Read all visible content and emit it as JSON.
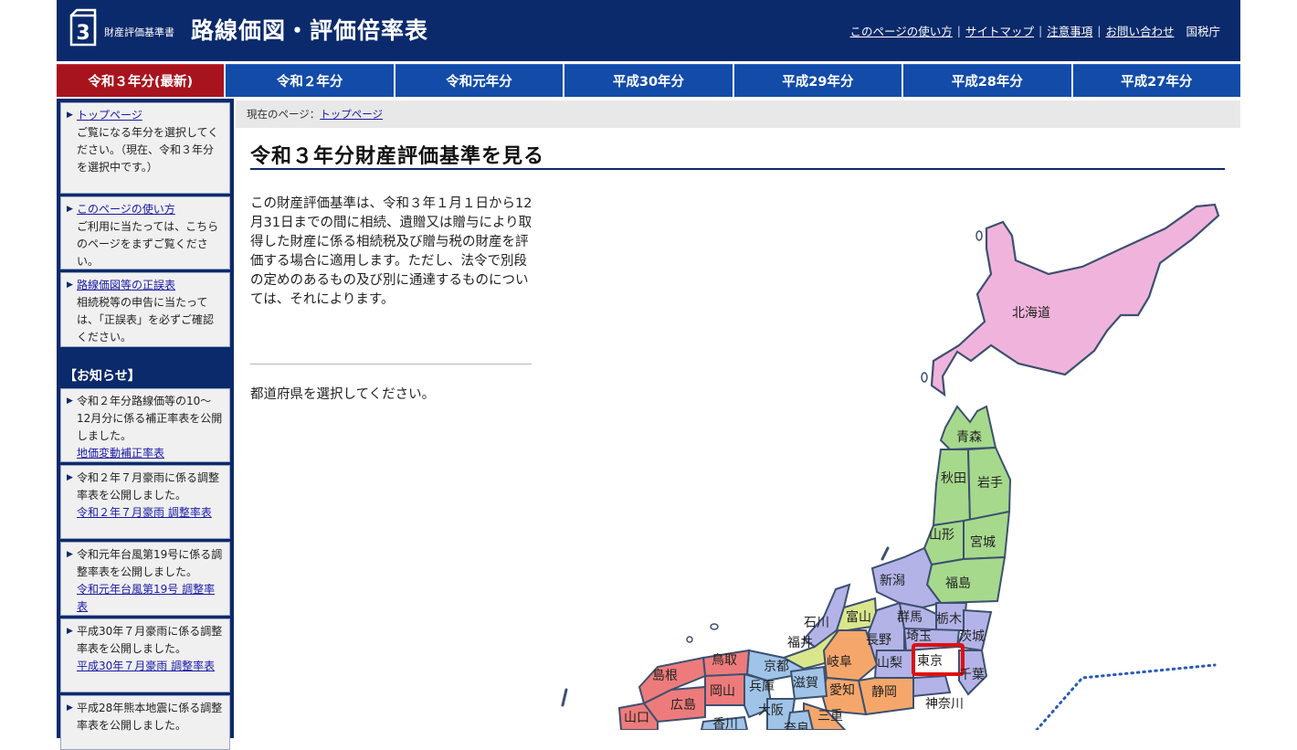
{
  "header": {
    "logo_number": "3",
    "logo_sub": "財産評価基準書",
    "logo_main": "路線価図・評価倍率表",
    "utility_links": [
      "このページの使い方",
      "サイトマップ",
      "注意事項",
      "お問い合わせ"
    ],
    "agency": "国税庁"
  },
  "tabs": [
    "令和３年分(最新)",
    "令和２年分",
    "令和元年分",
    "平成30年分",
    "平成29年分",
    "平成28年分",
    "平成27年分"
  ],
  "sidebar": {
    "top": {
      "link": "トップページ",
      "text": "ご覧になる年分を選択してください。（現在、令和３年分を選択中です。）"
    },
    "usage": {
      "link": "このページの使い方",
      "text": "ご利用に当たっては、こちらのページをまずご覧ください。"
    },
    "errata": {
      "link": "路線価図等の正誤表",
      "text": "相続税等の申告に当たっては、「正誤表」を必ずご確認ください。"
    },
    "notice_heading": "【お知らせ】",
    "notices": [
      {
        "text": "令和２年分路線価等の10～12月分に係る補正率表を公開しました。",
        "link": "地価変動補正率表"
      },
      {
        "text": "令和２年７月豪雨に係る調整率表を公開しました。",
        "link": "令和２年７月豪雨 調整率表"
      },
      {
        "text": "令和元年台風第19号に係る調整率表を公開しました。",
        "link": "令和元年台風第19号 調整率表"
      },
      {
        "text": "平成30年７月豪雨に係る調整率表を公開しました。",
        "link": "平成30年７月豪雨 調整率表"
      },
      {
        "text": "平成28年熊本地震に係る調整率表を公開しました。",
        "link": ""
      }
    ]
  },
  "breadcrumb": {
    "prefix": "現在のページ：",
    "link": "トップページ"
  },
  "main": {
    "title": "令和３年分財産評価基準を見る",
    "intro": "この財産評価基準は、令和３年１月１日から12月31日までの間に相続、遺贈又は贈与により取得した財産に係る相続税及び贈与税の財産を評価する場合に適用します。ただし、法令で別段の定めのあるもの及び別に通達するものについては、それによります。",
    "select_text": "都道府県を選択してください。"
  },
  "map": {
    "prefectures": [
      "北海道",
      "青森",
      "秋田",
      "岩手",
      "山形",
      "宮城",
      "新潟",
      "福島",
      "石川",
      "富山",
      "群馬",
      "栃木",
      "福井",
      "長野",
      "埼玉",
      "茨城",
      "山梨",
      "東京",
      "千葉",
      "神奈川",
      "岐阜",
      "静岡",
      "愛知",
      "京都",
      "滋賀",
      "三重",
      "奈良",
      "大阪",
      "兵庫",
      "鳥取",
      "岡山",
      "島根",
      "広島",
      "山口",
      "香川"
    ],
    "selected": "東京",
    "colors": {
      "hokkaido": "#f0b4dc",
      "tohoku": "#a6d98c",
      "kanto": "#b3b3e8",
      "chubu_north": "#d9e68c",
      "chubu": "#f5a76b",
      "kinki": "#a0c4e8",
      "chugoku": "#ee7b7b",
      "highlight": "#e01010"
    }
  }
}
